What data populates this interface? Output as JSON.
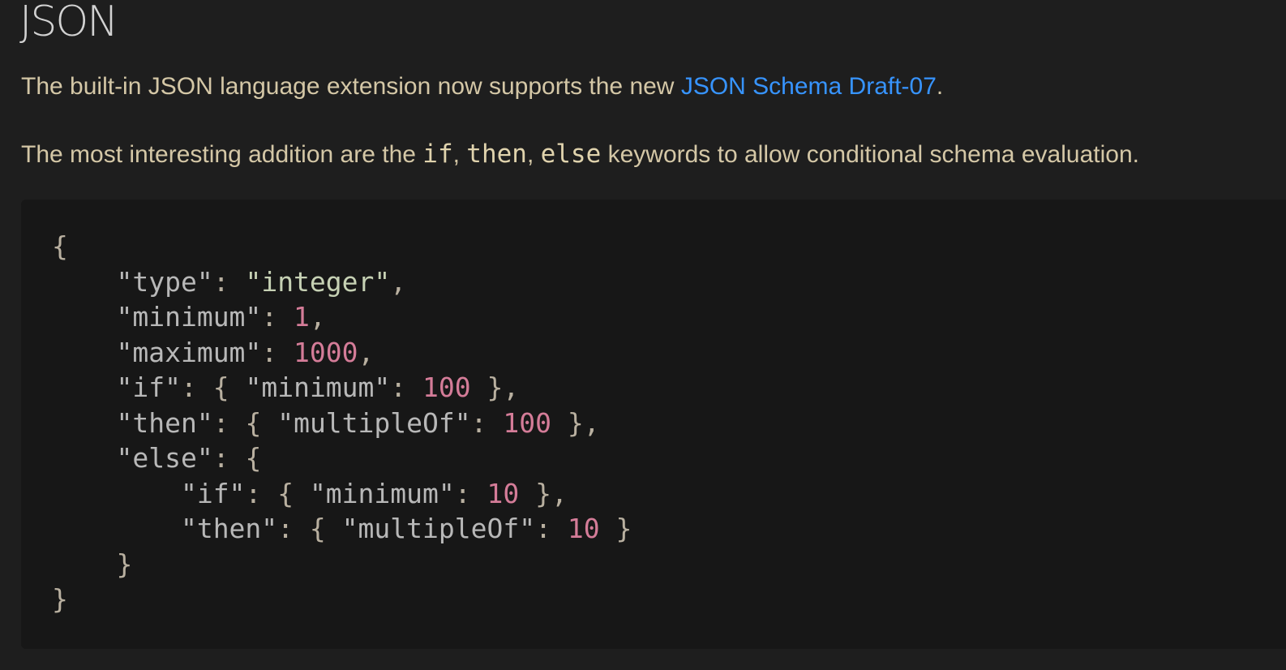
{
  "heading": "JSON",
  "para1": {
    "prefix": "The built-in JSON language extension now supports the new ",
    "link_text": "JSON Schema Draft-07",
    "suffix": "."
  },
  "para2": {
    "prefix": "The most interesting addition are the ",
    "kw_if": "if",
    "sep1": ", ",
    "kw_then": "then",
    "sep2": ", ",
    "kw_else": "else",
    "suffix": " keywords to allow conditional schema evaluation."
  },
  "code": {
    "l1": "{",
    "l2": {
      "indent": "    ",
      "key": "\"type\"",
      "colon": ": ",
      "value": "\"integer\"",
      "tail": ","
    },
    "l3": {
      "indent": "    ",
      "key": "\"minimum\"",
      "colon": ": ",
      "value": "1",
      "tail": ","
    },
    "l4": {
      "indent": "    ",
      "key": "\"maximum\"",
      "colon": ": ",
      "value": "1000",
      "tail": ","
    },
    "l5": {
      "indent": "    ",
      "key": "\"if\"",
      "colon": ": ",
      "open": "{ ",
      "ikey": "\"minimum\"",
      "icolon": ": ",
      "value": "100",
      "close": " },",
      "tail": ""
    },
    "l6": {
      "indent": "    ",
      "key": "\"then\"",
      "colon": ": ",
      "open": "{ ",
      "ikey": "\"multipleOf\"",
      "icolon": ": ",
      "value": "100",
      "close": " },",
      "tail": ""
    },
    "l7": {
      "indent": "    ",
      "key": "\"else\"",
      "colon": ": ",
      "open": "{"
    },
    "l8": {
      "indent": "        ",
      "key": "\"if\"",
      "colon": ": ",
      "open": "{ ",
      "ikey": "\"minimum\"",
      "icolon": ": ",
      "value": "10",
      "close": " },",
      "tail": ""
    },
    "l9": {
      "indent": "        ",
      "key": "\"then\"",
      "colon": ": ",
      "open": "{ ",
      "ikey": "\"multipleOf\"",
      "icolon": ": ",
      "value": "10",
      "close": " }",
      "tail": ""
    },
    "l10": {
      "indent": "    ",
      "text": "}"
    },
    "l11": "}"
  }
}
